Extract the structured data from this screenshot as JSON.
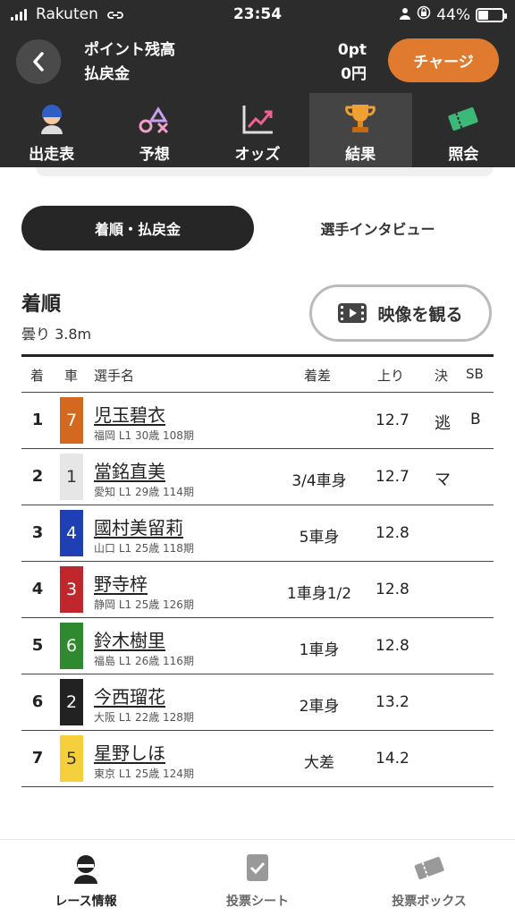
{
  "status_bar": {
    "carrier": "Rakuten",
    "time": "23:54",
    "battery": "44%",
    "battery_level": 0.44
  },
  "header": {
    "points_label": "ポイント残高",
    "refund_label": "払戻金",
    "points_value": "0pt",
    "refund_value": "0円",
    "charge_label": "チャージ"
  },
  "tabs": [
    {
      "label": "出走表",
      "icon": "racer-icon",
      "active": false
    },
    {
      "label": "予想",
      "icon": "prediction-icon",
      "active": false
    },
    {
      "label": "オッズ",
      "icon": "odds-chart-icon",
      "active": false
    },
    {
      "label": "結果",
      "icon": "trophy-icon",
      "active": true
    },
    {
      "label": "照会",
      "icon": "ticket-icon",
      "active": false
    }
  ],
  "segment": {
    "active": "着順・払戻金",
    "other": "選手インタビュー"
  },
  "section": {
    "title": "着順",
    "condition": "曇り 3.8m",
    "video_label": "映像を観る"
  },
  "table": {
    "headers": {
      "rank": "着",
      "car": "車",
      "name": "選手名",
      "margin": "着差",
      "agari": "上り",
      "kimarite": "決",
      "sb": "SB"
    },
    "rows": [
      {
        "rank": "1",
        "car": "7",
        "car_bg": "#d2691e",
        "car_fg": "#ffffff",
        "name": "児玉碧衣",
        "info": "福岡 L1 30歳 108期",
        "margin": "",
        "agari": "12.7",
        "kimarite": "逃",
        "sb": "B"
      },
      {
        "rank": "2",
        "car": "1",
        "car_bg": "#e6e6e6",
        "car_fg": "#333333",
        "name": "當銘直美",
        "info": "愛知 L1 29歳 114期",
        "margin": "3/4車身",
        "agari": "12.7",
        "kimarite": "マ",
        "sb": ""
      },
      {
        "rank": "3",
        "car": "4",
        "car_bg": "#1f3fb5",
        "car_fg": "#ffffff",
        "name": "國村美留莉",
        "info": "山口 L1 25歳 118期",
        "margin": "5車身",
        "agari": "12.8",
        "kimarite": "",
        "sb": ""
      },
      {
        "rank": "4",
        "car": "3",
        "car_bg": "#c0272d",
        "car_fg": "#ffffff",
        "name": "野寺梓",
        "info": "静岡 L1 25歳 126期",
        "margin": "1車身1/2",
        "agari": "12.8",
        "kimarite": "",
        "sb": ""
      },
      {
        "rank": "5",
        "car": "6",
        "car_bg": "#2f8a2f",
        "car_fg": "#ffffff",
        "name": "鈴木樹里",
        "info": "福島 L1 26歳 116期",
        "margin": "1車身",
        "agari": "12.8",
        "kimarite": "",
        "sb": ""
      },
      {
        "rank": "6",
        "car": "2",
        "car_bg": "#222222",
        "car_fg": "#ffffff",
        "name": "今西瑠花",
        "info": "大阪 L1 22歳 128期",
        "margin": "2車身",
        "agari": "13.2",
        "kimarite": "",
        "sb": ""
      },
      {
        "rank": "7",
        "car": "5",
        "car_bg": "#f5cf3c",
        "car_fg": "#333333",
        "name": "星野しほ",
        "info": "東京 L1 25歳 124期",
        "margin": "大差",
        "agari": "14.2",
        "kimarite": "",
        "sb": ""
      }
    ]
  },
  "bottom_nav": [
    {
      "label": "レース情報",
      "icon": "race-info-icon",
      "active": true
    },
    {
      "label": "投票シート",
      "icon": "vote-sheet-icon",
      "active": false
    },
    {
      "label": "投票ボックス",
      "icon": "vote-box-icon",
      "active": false
    }
  ]
}
